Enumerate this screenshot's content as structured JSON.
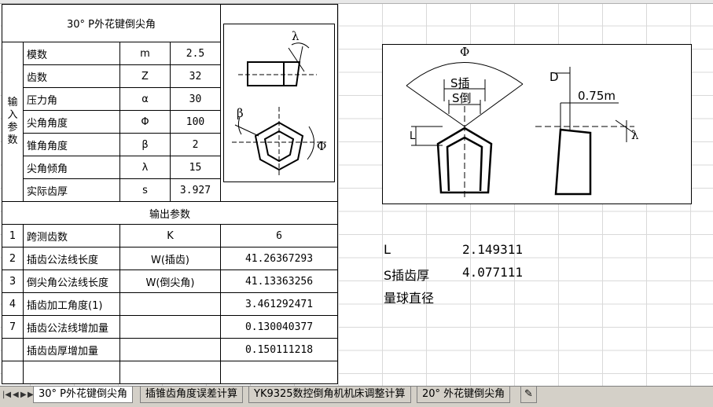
{
  "title": "30° P外花键倒尖角",
  "input_section": "输入参数",
  "inputs": [
    {
      "label": "模数",
      "symbol": "m",
      "value": "2.5"
    },
    {
      "label": "齿数",
      "symbol": "Z",
      "value": "32"
    },
    {
      "label": "压力角",
      "symbol": "α",
      "value": "30"
    },
    {
      "label": "尖角角度",
      "symbol": "Φ",
      "value": "100"
    },
    {
      "label": "锥角角度",
      "symbol": "β",
      "value": "2"
    },
    {
      "label": "尖角倾角",
      "symbol": "λ",
      "value": "15"
    },
    {
      "label": "实际齿厚",
      "symbol": "s",
      "value": "3.927"
    }
  ],
  "output_section": "输出参数",
  "outputs": [
    {
      "no": "1",
      "label": "跨测齿数",
      "symbol": "K",
      "value": "6"
    },
    {
      "no": "2",
      "label": "插齿公法线长度",
      "symbol": "W(插齿)",
      "value": "41.26367293"
    },
    {
      "no": "3",
      "label": "倒尖角公法线长度",
      "symbol": "W(倒尖角)",
      "value": "41.13363256"
    },
    {
      "no": "4",
      "label": "插齿加工角度(1)",
      "symbol": "",
      "value": "3.461292471"
    },
    {
      "no": "7",
      "label": "插齿公法线增加量",
      "symbol": "",
      "value": "0.130040377"
    },
    {
      "no": "",
      "label": "插齿齿厚增加量",
      "symbol": "",
      "value": "0.150111218"
    }
  ],
  "diagram1": {
    "lambda": "λ",
    "beta": "β",
    "phi": "Φ"
  },
  "diagram2": {
    "phi": "Φ",
    "s_insert": "S插",
    "s_chamfer": "S倒",
    "l": "L",
    "d": "D",
    "dim": "0.75m",
    "lambda": "λ"
  },
  "results": [
    {
      "label": "L",
      "value": "2.149311"
    },
    {
      "label": "S插齿厚",
      "value": "4.077111"
    },
    {
      "label": "量球直径",
      "value": ""
    }
  ],
  "tabs": [
    "30° P外花键倒尖角",
    "插锥齿角度误差计算",
    "YK9325数控倒角机机床调整计算",
    "20° 外花键倒尖角"
  ]
}
